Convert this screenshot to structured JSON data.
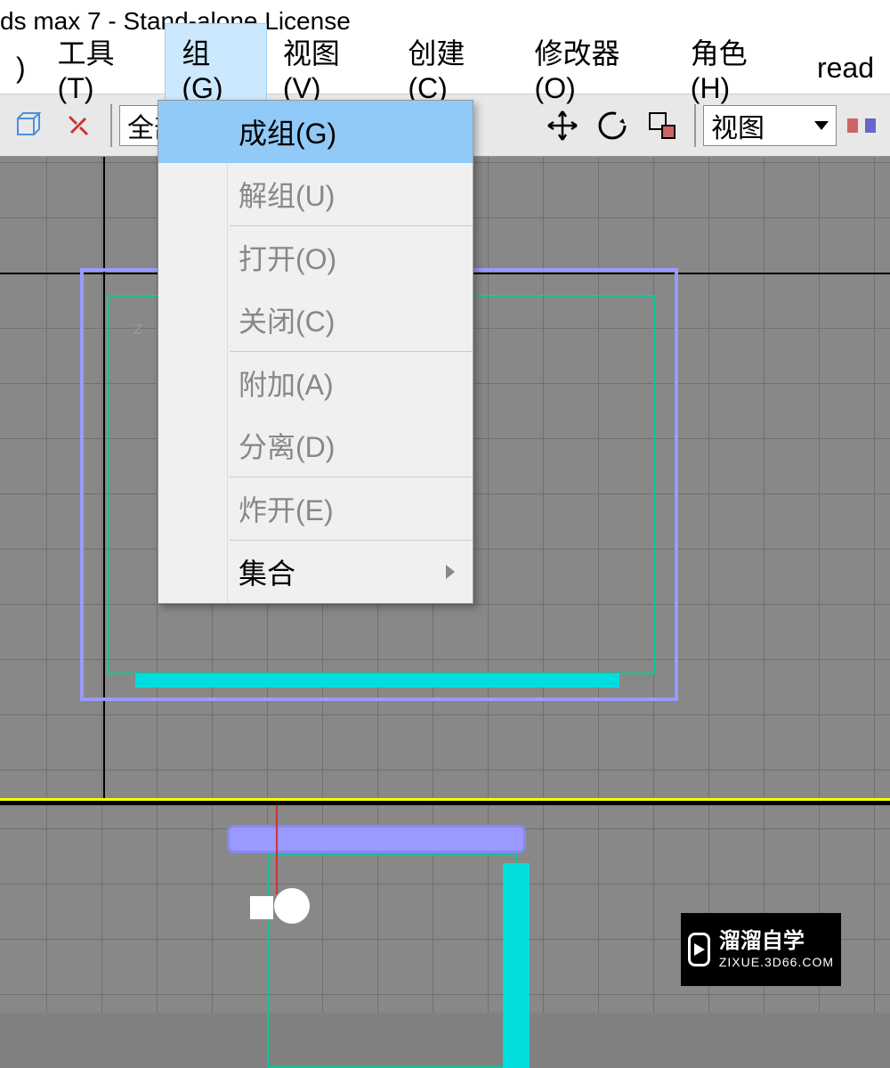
{
  "title": "ds max 7  - Stand-alone License",
  "menubar": {
    "items": [
      {
        "label": ")",
        "active": false
      },
      {
        "label": "工具(T)",
        "active": false
      },
      {
        "label": "组(G)",
        "active": true
      },
      {
        "label": "视图(V)",
        "active": false
      },
      {
        "label": "创建(C)",
        "active": false
      },
      {
        "label": "修改器(O)",
        "active": false
      },
      {
        "label": "角色(H)",
        "active": false
      },
      {
        "label": "read",
        "active": false
      }
    ]
  },
  "toolbar": {
    "all_label": "全部",
    "dropdown_label": "视图"
  },
  "context_menu": {
    "items": [
      {
        "label": "成组(G)",
        "enabled": true,
        "highlighted": true
      },
      {
        "label": "解组(U)",
        "enabled": false
      },
      {
        "label": "打开(O)",
        "enabled": false
      },
      {
        "label": "关闭(C)",
        "enabled": false
      },
      {
        "label": "附加(A)",
        "enabled": false
      },
      {
        "label": "分离(D)",
        "enabled": false
      },
      {
        "label": "炸开(E)",
        "enabled": false
      },
      {
        "label": "集合",
        "enabled": true,
        "submenu": true
      }
    ]
  },
  "axis": {
    "z": "z"
  },
  "watermark": {
    "main": "溜溜自学",
    "sub": "ZIXUE.3D66.COM"
  }
}
